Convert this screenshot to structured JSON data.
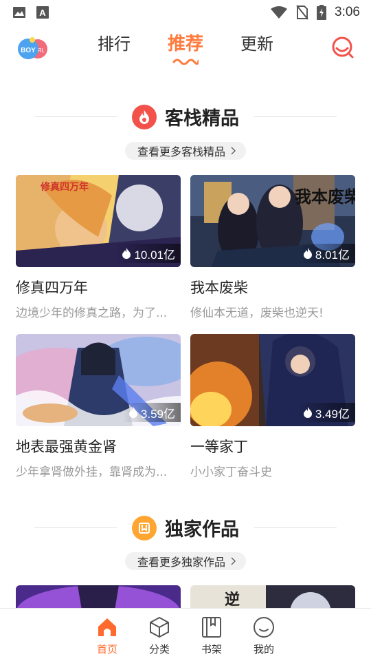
{
  "status_bar": {
    "time": "3:06",
    "left_icons": [
      "image-icon",
      "font-icon"
    ],
    "right_icons": [
      "wifi-icon",
      "no-sim-icon",
      "battery-charging-icon"
    ]
  },
  "header": {
    "logo_text": "BOY",
    "tabs": [
      {
        "label": "排行",
        "active": false
      },
      {
        "label": "推荐",
        "active": true
      },
      {
        "label": "更新",
        "active": false
      }
    ],
    "accent_color": "#ff7a3d"
  },
  "sections": [
    {
      "title": "客栈精品",
      "more_label": "查看更多客栈精品",
      "icon": "flame-icon",
      "items": [
        {
          "title": "修真四万年",
          "desc": "边境少年的修真之路，为了...",
          "hot": "10.01亿",
          "cover_text": "修真四万年"
        },
        {
          "title": "我本废柴",
          "desc": "修仙本无道，废柴也逆天!",
          "hot": "8.01亿",
          "cover_text": "我本废柴"
        },
        {
          "title": "地表最强黄金肾",
          "desc": "少年拿肾做外挂，靠肾成为...",
          "hot": "3.59亿"
        },
        {
          "title": "一等家丁",
          "desc": "小小家丁奋斗史",
          "hot": "3.49亿"
        }
      ]
    },
    {
      "title": "独家作品",
      "more_label": "查看更多独家作品",
      "icon": "bookmark-icon",
      "items": [
        {
          "cover_text": ""
        },
        {
          "cover_text": "逆"
        }
      ]
    }
  ],
  "bottom_nav": [
    {
      "label": "首页",
      "icon": "home-icon",
      "active": true
    },
    {
      "label": "分类",
      "icon": "cube-icon",
      "active": false
    },
    {
      "label": "书架",
      "icon": "bookshelf-icon",
      "active": false
    },
    {
      "label": "我的",
      "icon": "smile-icon",
      "active": false
    }
  ]
}
